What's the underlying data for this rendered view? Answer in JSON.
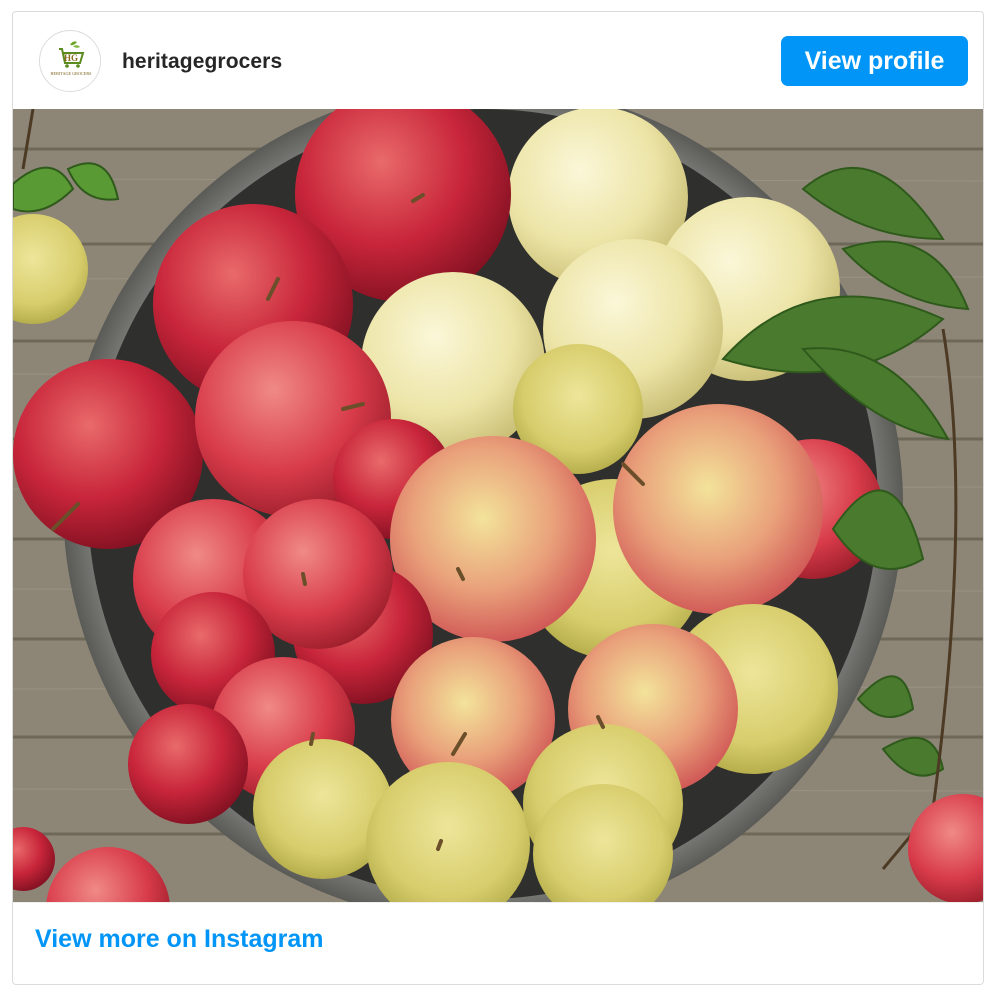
{
  "post": {
    "username": "heritagegrocers",
    "avatar_logo_text": "HERITAGE GROCERS",
    "view_profile_label": "View profile",
    "view_more_label": "View more on Instagram"
  },
  "colors": {
    "accent": "#0095f6",
    "text": "#262626",
    "border": "#dbdbdb"
  },
  "image": {
    "description_icon": "bowl-of-apples-photo"
  }
}
